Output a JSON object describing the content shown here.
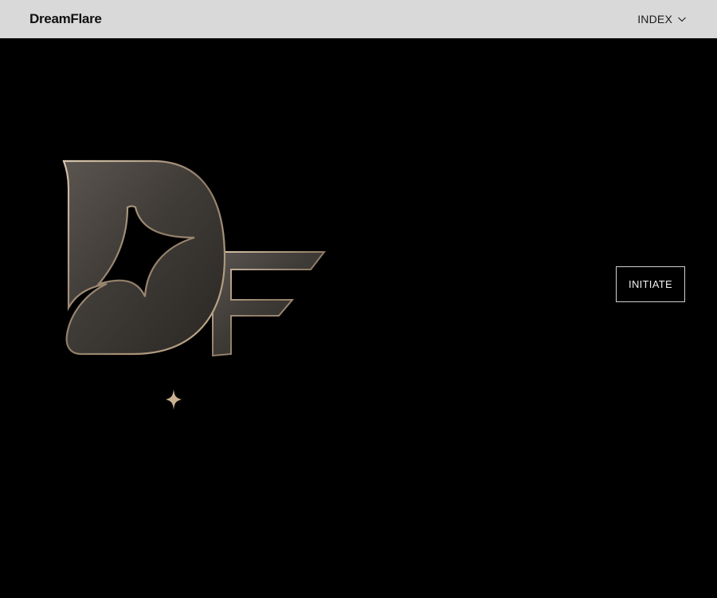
{
  "header": {
    "brand": "DreamFlare",
    "index_label": "INDEX",
    "index_icon": "chevron-down-icon",
    "background": "#d9d9d9"
  },
  "hero": {
    "logo_icon": "dreamflare-df-logo",
    "divider_icon": "sparkle-star-icon",
    "cta_label": "INITIATE",
    "background": "#000000",
    "accent": "#b8a38a"
  }
}
